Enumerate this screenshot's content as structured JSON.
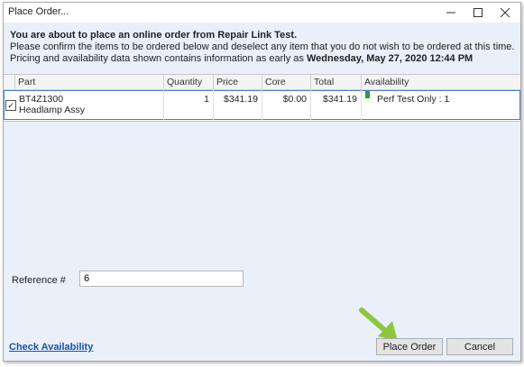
{
  "window": {
    "title": "Place Order...",
    "minimize_icon": "minimize-icon",
    "maximize_icon": "maximize-icon",
    "close_icon": "close-icon"
  },
  "intro": {
    "headline": "You are about to place an online order from Repair Link Test.",
    "line2": "Please confirm the items to be ordered below and deselect any item that you do not wish to be ordered at this time.",
    "line3_prefix": "Pricing and availability data shown contains information as early as",
    "line3_date": "Wednesday, May 27, 2020 12:44 PM"
  },
  "grid": {
    "columns": [
      "Part",
      "Quantity",
      "Price",
      "Core",
      "Total",
      "Availability"
    ],
    "rows": [
      {
        "checked": true,
        "part_number": "BT4Z1300",
        "part_name": "Headlamp Assy",
        "quantity": "1",
        "price": "$341.19",
        "core": "$0.00",
        "total": "$341.19",
        "availability": "Perf Test Only : 1",
        "availability_color": "#2f9a2f"
      }
    ]
  },
  "reference": {
    "label": "Reference #",
    "value": "6"
  },
  "footer": {
    "check_availability_link": "Check Availability",
    "place_order_button": "Place Order",
    "cancel_button": "Cancel"
  },
  "colors": {
    "accent_link": "#1a52a8",
    "panel_bg": "#e9f0fa",
    "arrow": "#8dc63f"
  }
}
